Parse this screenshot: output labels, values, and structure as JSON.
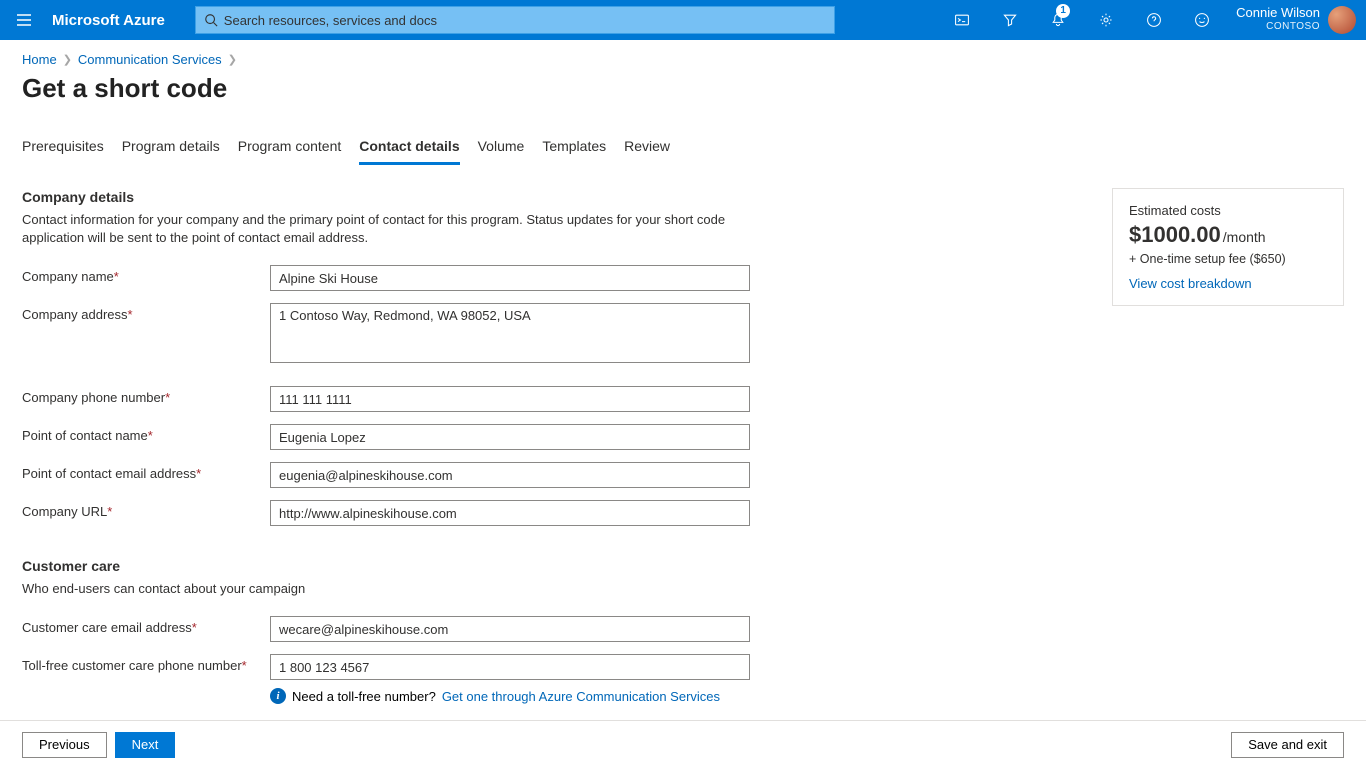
{
  "top": {
    "brand": "Microsoft Azure",
    "search_placeholder": "Search resources, services and docs",
    "notification_badge": "1",
    "user_name": "Connie Wilson",
    "user_dir": "CONTOSO"
  },
  "breadcrumb": {
    "home": "Home",
    "level1": "Communication Services"
  },
  "page_title": "Get a short code",
  "tabs": [
    {
      "label": "Prerequisites"
    },
    {
      "label": "Program details"
    },
    {
      "label": "Program content"
    },
    {
      "label": "Contact details"
    },
    {
      "label": "Volume"
    },
    {
      "label": "Templates"
    },
    {
      "label": "Review"
    }
  ],
  "active_tab_index": 3,
  "company_details": {
    "heading": "Company details",
    "description": "Contact information for your company and the primary point of contact for this program. Status updates for your short code application will be sent to the point of contact email address.",
    "fields": {
      "company_name_label": "Company name",
      "company_name_value": "Alpine Ski House",
      "company_address_label": "Company address",
      "company_address_value": "1 Contoso Way, Redmond, WA 98052, USA",
      "company_phone_label": "Company phone number",
      "company_phone_value": "111 111 1111",
      "poc_name_label": "Point of contact name",
      "poc_name_value": "Eugenia Lopez",
      "poc_email_label": "Point of contact email address",
      "poc_email_value": "eugenia@alpineskihouse.com",
      "company_url_label": "Company URL",
      "company_url_value": "http://www.alpineskihouse.com"
    }
  },
  "customer_care": {
    "heading": "Customer care",
    "description": "Who end-users can contact about your campaign",
    "fields": {
      "cc_email_label": "Customer care email address",
      "cc_email_value": "wecare@alpineskihouse.com",
      "cc_phone_label": "Toll-free customer care phone number",
      "cc_phone_value": "1 800 123 4567"
    },
    "hint_text": "Need a toll-free number? ",
    "hint_link": "Get one through Azure Communication Services"
  },
  "cost": {
    "header": "Estimated costs",
    "amount": "$1000.00",
    "period": "/month",
    "fee": "+ One-time setup fee ($650)",
    "link": "View cost breakdown"
  },
  "footer": {
    "previous": "Previous",
    "next": "Next",
    "save_exit": "Save and exit"
  }
}
